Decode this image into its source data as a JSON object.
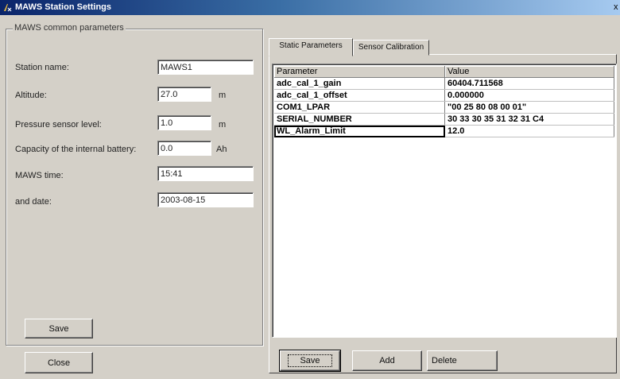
{
  "window": {
    "title": "MAWS Station Settings",
    "close_glyph": "x"
  },
  "common": {
    "legend": "MAWS common parameters",
    "station_name": {
      "label": "Station name:",
      "value": "MAWS1"
    },
    "altitude": {
      "label": "Altitude:",
      "value": "27.0",
      "unit": "m"
    },
    "pressure_level": {
      "label": "Pressure sensor level:",
      "value": "1.0",
      "unit": "m"
    },
    "battery": {
      "label": "Capacity of the internal battery:",
      "value": "0.0",
      "unit": "Ah"
    },
    "time": {
      "label": "MAWS time:",
      "value": "15:41"
    },
    "date": {
      "label": "and date:",
      "value": "2003-08-15"
    },
    "save_label": "Save"
  },
  "close_label": "Close",
  "tabs": [
    {
      "label": "Static Parameters",
      "active": true
    },
    {
      "label": "Sensor Calibration",
      "active": false
    }
  ],
  "grid": {
    "headers": [
      "Parameter",
      "Value"
    ],
    "rows": [
      {
        "parameter": "adc_cal_1_gain",
        "value": "60404.711568"
      },
      {
        "parameter": "adc_cal_1_offset",
        "value": "0.000000"
      },
      {
        "parameter": "COM1_LPAR",
        "value": "\"00 25 80 08 00 01\""
      },
      {
        "parameter": "SERIAL_NUMBER",
        "value": "30 33 30 35 31 32 31 C4"
      },
      {
        "parameter": "WL_Alarm_Limit",
        "value": "12.0"
      }
    ],
    "selected_row": 4
  },
  "buttons": {
    "save": "Save",
    "add": "Add",
    "delete": "Delete"
  },
  "colors": {
    "titlebar_start": "#0a246a",
    "titlebar_end": "#a6caf0",
    "face": "#d4d0c8"
  }
}
